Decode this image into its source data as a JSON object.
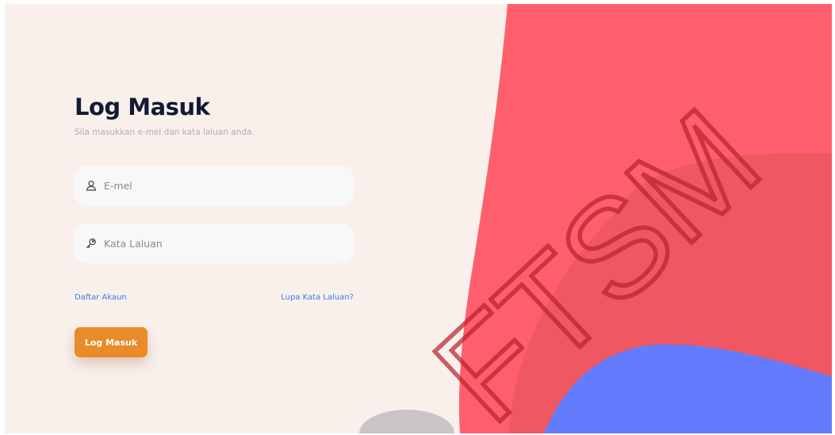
{
  "login": {
    "title": "Log Masuk",
    "subtitle": "Sila masukkan e-mel dan kata laluan anda.",
    "email_placeholder": "E-mel",
    "password_placeholder": "Kata Laluan",
    "register_link": "Daftar Akaun",
    "forgot_link": "Lupa Kata Laluan?",
    "submit_label": "Log Masuk"
  },
  "watermark": {
    "text": "FTSM"
  },
  "icons": {
    "email": "user-icon",
    "password": "key-icon"
  },
  "colors": {
    "background": "#f9f0ec",
    "title": "#141a33",
    "accent_button": "#e98b29",
    "link": "#3d7be0",
    "shape_red": "#ff5f6d",
    "shape_blue": "#627cfd"
  }
}
